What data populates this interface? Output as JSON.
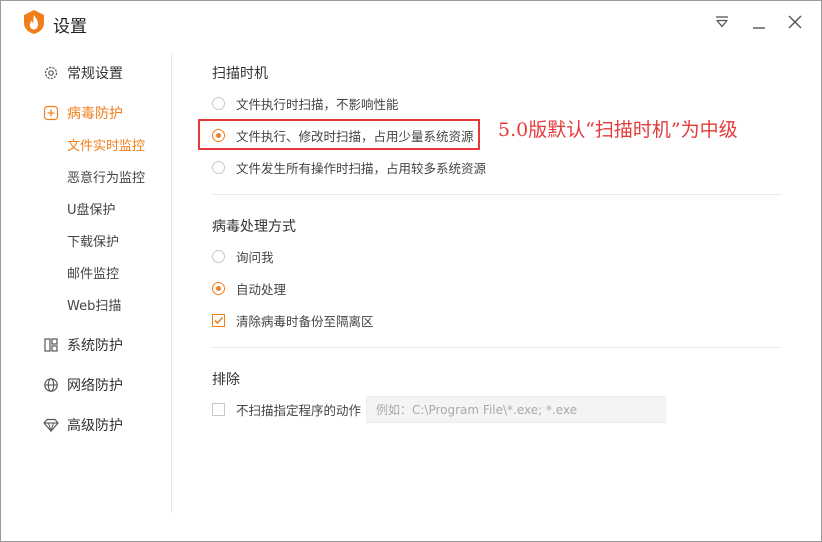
{
  "window": {
    "title": "设置",
    "accent_color": "#f07f1b",
    "annotation_color": "#e43a3a"
  },
  "titlebar_icons": [
    "dropdown-icon",
    "minimize-icon",
    "close-icon"
  ],
  "sidebar": {
    "items": [
      {
        "label": "常规设置",
        "icon": "gear-icon"
      },
      {
        "label": "病毒防护",
        "icon": "plus-square-icon",
        "active": true
      },
      {
        "label": "系统防护",
        "icon": "grid-icon"
      },
      {
        "label": "网络防护",
        "icon": "globe-icon"
      },
      {
        "label": "高级防护",
        "icon": "diamond-icon"
      }
    ],
    "subitems": [
      {
        "label": "文件实时监控",
        "active": true
      },
      {
        "label": "恶意行为监控"
      },
      {
        "label": "U盘保护"
      },
      {
        "label": "下载保护"
      },
      {
        "label": "邮件监控"
      },
      {
        "label": "Web扫描"
      }
    ]
  },
  "scan_timing": {
    "title": "扫描时机",
    "options": [
      {
        "label": "文件执行时扫描，不影响性能",
        "checked": false
      },
      {
        "label": "文件执行、修改时扫描，占用少量系统资源",
        "checked": true
      },
      {
        "label": "文件发生所有操作时扫描，占用较多系统资源",
        "checked": false
      }
    ]
  },
  "annotation": "5.0版默认“扫描时机”为中级",
  "virus_handling": {
    "title": "病毒处理方式",
    "options": [
      {
        "label": "询问我",
        "checked": false
      },
      {
        "label": "自动处理",
        "checked": true
      }
    ],
    "backup_checkbox": {
      "label": "清除病毒时备份至隔离区",
      "checked": true
    }
  },
  "exclude": {
    "title": "排除",
    "checkbox": {
      "label": "不扫描指定程序的动作",
      "checked": false
    },
    "input_placeholder": "例如：C:\\Program File\\*.exe; *.exe",
    "input_value": ""
  }
}
